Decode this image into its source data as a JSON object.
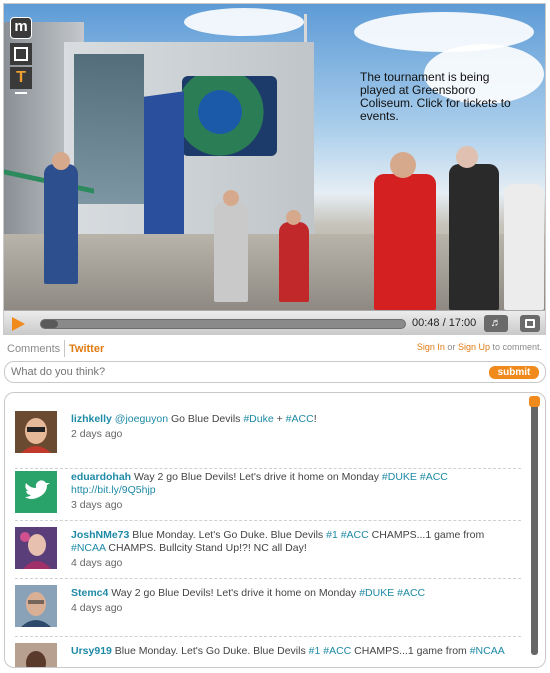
{
  "video": {
    "overlay_note": "The tournament is being played at Greensboro Coliseum.  Click for tickets to events.",
    "logo": "m",
    "tool_text": "T",
    "time_current": "00:48",
    "time_total": "17:00",
    "time_separator": " / ",
    "progress_fraction": 0.047,
    "icons": [
      "play-icon",
      "volume-icon",
      "fullscreen-icon"
    ]
  },
  "tabs": {
    "comments": "Comments",
    "twitter": "Twitter"
  },
  "auth": {
    "sign_in": "Sign In",
    "or": " or ",
    "sign_up": "Sign Up",
    "suffix": " to comment."
  },
  "input": {
    "placeholder": "What do you think?",
    "submit": "submit"
  },
  "colors": {
    "accent": "#f08a1c",
    "link": "#1e8aa6"
  },
  "feed": [
    {
      "user": "lizhkelly",
      "segments": [
        {
          "t": " ",
          "tag": false
        },
        {
          "t": "@joeguyon",
          "tag": true
        },
        {
          "t": " Go Blue Devils ",
          "tag": false
        },
        {
          "t": "#Duke",
          "tag": true
        },
        {
          "t": " + ",
          "tag": false
        },
        {
          "t": "#ACC",
          "tag": true
        },
        {
          "t": "!",
          "tag": false
        }
      ],
      "time": "2 days ago"
    },
    {
      "user": "eduardohah",
      "segments": [
        {
          "t": " Way 2 go Blue Devils! Let's drive it home on Monday ",
          "tag": false
        },
        {
          "t": "#DUKE",
          "tag": true
        },
        {
          "t": " ",
          "tag": false
        },
        {
          "t": "#ACC",
          "tag": true
        },
        {
          "t": " ",
          "tag": false
        },
        {
          "t": "http://bit.ly/9Q5hjp",
          "tag": true
        }
      ],
      "time": "3 days ago"
    },
    {
      "user": "JoshNMe73",
      "segments": [
        {
          "t": " Blue Monday. Let's Go Duke. Blue Devils ",
          "tag": false
        },
        {
          "t": "#1",
          "tag": true
        },
        {
          "t": " ",
          "tag": false
        },
        {
          "t": "#ACC",
          "tag": true
        },
        {
          "t": " CHAMPS...1 game from ",
          "tag": false
        },
        {
          "t": "#NCAA",
          "tag": true
        },
        {
          "t": " CHAMPS. Bullcity Stand Up!?! NC all Day!",
          "tag": false
        }
      ],
      "time": "4 days ago"
    },
    {
      "user": "Stemc4",
      "segments": [
        {
          "t": " Way 2 go Blue Devils! Let's drive it home on Monday ",
          "tag": false
        },
        {
          "t": "#DUKE",
          "tag": true
        },
        {
          "t": " ",
          "tag": false
        },
        {
          "t": "#ACC",
          "tag": true
        }
      ],
      "time": "4 days ago"
    },
    {
      "user": "Ursy919",
      "segments": [
        {
          "t": " Blue Monday. Let's Go Duke. Blue Devils ",
          "tag": false
        },
        {
          "t": "#1",
          "tag": true
        },
        {
          "t": " ",
          "tag": false
        },
        {
          "t": "#ACC",
          "tag": true
        },
        {
          "t": " CHAMPS...1 game from ",
          "tag": false
        },
        {
          "t": "#NCAA",
          "tag": true
        }
      ],
      "time": ""
    }
  ]
}
